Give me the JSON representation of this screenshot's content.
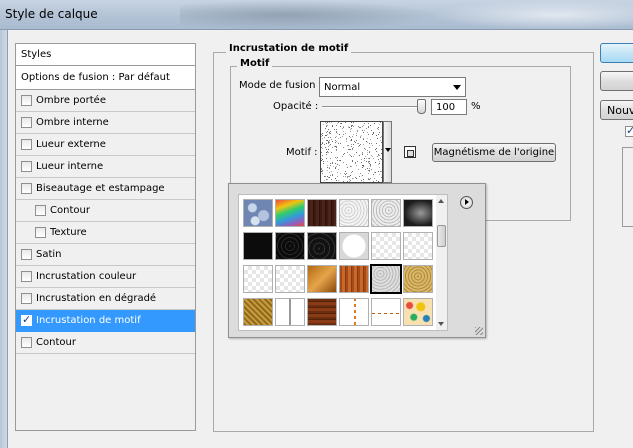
{
  "window": {
    "title": "Style de calque"
  },
  "styles_panel": {
    "header": "Styles",
    "blend_options": "Options de fusion : Par défaut",
    "items": [
      {
        "label": "Ombre portée",
        "checked": false
      },
      {
        "label": "Ombre interne",
        "checked": false
      },
      {
        "label": "Lueur externe",
        "checked": false
      },
      {
        "label": "Lueur interne",
        "checked": false
      },
      {
        "label": "Biseautage et estampage",
        "checked": false
      },
      {
        "label": "Contour",
        "checked": false
      },
      {
        "label": "Texture",
        "checked": false
      },
      {
        "label": "Satin",
        "checked": false
      },
      {
        "label": "Incrustation couleur",
        "checked": false
      },
      {
        "label": "Incrustation en dégradé",
        "checked": false
      },
      {
        "label": "Incrustation de motif",
        "checked": true
      },
      {
        "label": "Contour",
        "checked": false
      }
    ]
  },
  "pattern_overlay": {
    "group_title": "Incrustation de motif",
    "subgroup_title": "Motif",
    "blend_mode_label": "Mode de fusion :",
    "blend_mode_value": "Normal",
    "opacity_label": "Opacité :",
    "opacity_value": "100",
    "opacity_fraction": 1.0,
    "opacity_unit": "%",
    "pattern_label": "Motif :",
    "snap_button": "Magnétisme de l'origine"
  },
  "pattern_picker": {
    "tile_styles": [
      "bubbles",
      "rainbow",
      "wood-dark",
      "noise-light",
      "noise-checker",
      "noise-dark",
      "black",
      "black-noise",
      "black-noise2",
      "white-circle",
      "white-checker",
      "white-checker",
      "white-checker",
      "white-checker",
      "gold",
      "wood-orange",
      "gray-noise",
      "gold-noise",
      "gold-weave",
      "thin-lines",
      "wood-brown",
      "dashed-orange",
      "dashed-gray",
      "dots-color"
    ]
  },
  "right_buttons": {
    "new_label": "Nouv"
  },
  "colors": {
    "selection": "#3399ff",
    "dialog_bg": "#f0f0f0",
    "titlebar": "#b9c8da"
  }
}
